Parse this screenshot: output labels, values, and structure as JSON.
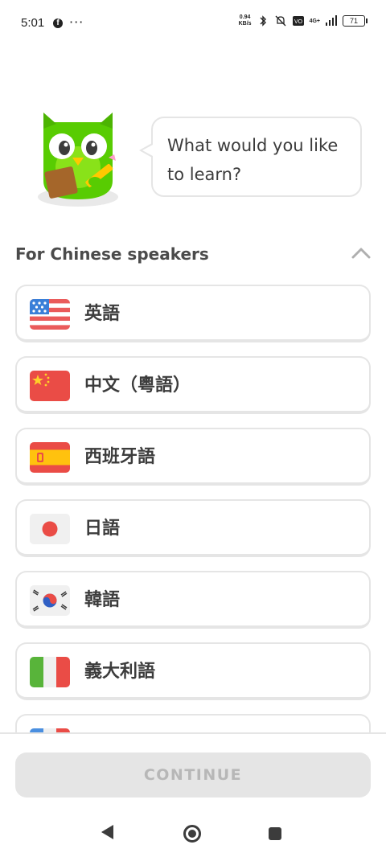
{
  "status_bar": {
    "time": "5:01",
    "net_speed_value": "0.94",
    "net_speed_unit": "KB/s",
    "network": "4G+",
    "battery": "71"
  },
  "prompt": {
    "question": "What would you like to learn?"
  },
  "section": {
    "title": "For Chinese speakers"
  },
  "languages": [
    {
      "label": "英語",
      "flag": "us-flag"
    },
    {
      "label": "中文（粵語）",
      "flag": "china-flag"
    },
    {
      "label": "西班牙語",
      "flag": "spain-flag"
    },
    {
      "label": "日語",
      "flag": "japan-flag"
    },
    {
      "label": "韓語",
      "flag": "korea-flag"
    },
    {
      "label": "義大利語",
      "flag": "italy-flag"
    },
    {
      "label": "",
      "flag": "france-flag"
    }
  ],
  "footer": {
    "continue_label": "CONTINUE"
  },
  "colors": {
    "owl_green": "#58cc02",
    "border": "#e5e5e5",
    "disabled_button": "#e5e5e5",
    "disabled_text": "#b7b7b7"
  }
}
